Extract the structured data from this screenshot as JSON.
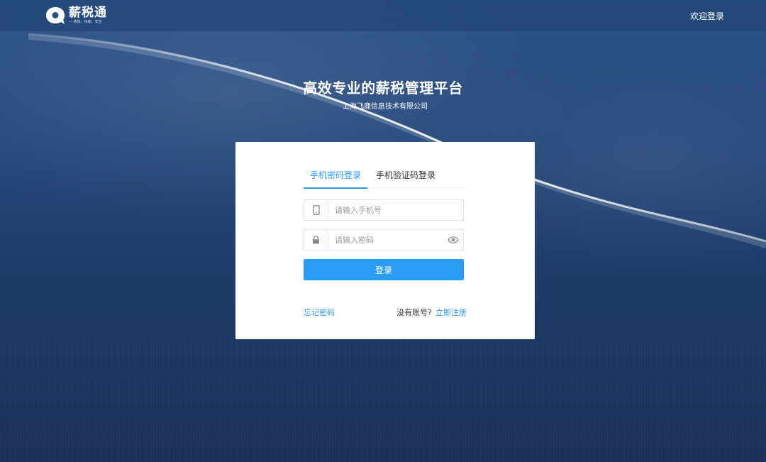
{
  "header": {
    "brand_name": "薪税通",
    "brand_slogan": "— 高效、快速、安全",
    "welcome_link": "欢迎登录"
  },
  "hero": {
    "title": "高效专业的薪税管理平台",
    "company": "上海飞鹿信息技术有限公司"
  },
  "login_card": {
    "tabs": [
      {
        "label": "手机密码登录",
        "active": true
      },
      {
        "label": "手机验证码登录",
        "active": false
      }
    ],
    "phone_field": {
      "placeholder": "请输入手机号",
      "value": "",
      "icon": "mobile-phone-icon"
    },
    "password_field": {
      "placeholder": "请输入密码",
      "value": "",
      "icon": "lock-icon",
      "toggle_icon": "eye-icon"
    },
    "login_button": "登录",
    "forgot_password": "忘记密码",
    "no_account_text": "没有账号?",
    "register_link": "立即注册"
  },
  "colors": {
    "accent": "#2b9bf3",
    "background_top": "#2b5287",
    "background_bottom": "#1a3159"
  }
}
